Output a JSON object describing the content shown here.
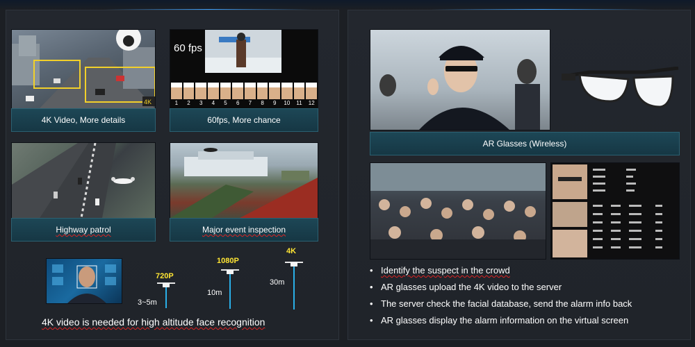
{
  "left": {
    "tiles": [
      {
        "caption": "4K Video, More details"
      },
      {
        "caption": "60fps, More chance",
        "fps_label": "60 fps",
        "frame_numbers": [
          "1",
          "2",
          "3",
          "4",
          "5",
          "6",
          "7",
          "8",
          "9",
          "10",
          "11",
          "12"
        ]
      },
      {
        "caption": "Highway patrol"
      },
      {
        "caption": "Major event inspection"
      }
    ],
    "altitude": {
      "drones": [
        {
          "resolution": "720P",
          "distance": "3~5m"
        },
        {
          "resolution": "1080P",
          "distance": "10m"
        },
        {
          "resolution": "4K",
          "distance": "30m"
        }
      ],
      "summary": "4K video is needed for high altitude face recognition"
    }
  },
  "right": {
    "ar_caption": "AR Glasses (Wireless)",
    "bullets": [
      "Identify the suspect in the crowd",
      "AR glasses upload the 4K video to the server",
      "The server check the facial database, send the alarm info back",
      "AR glasses display the alarm information on the virtual screen"
    ]
  },
  "colors": {
    "accent": "#3aa0ff",
    "caption_bg": "#1d4756",
    "drone_label": "#ffe534",
    "drone_line": "#2ab0e8"
  }
}
